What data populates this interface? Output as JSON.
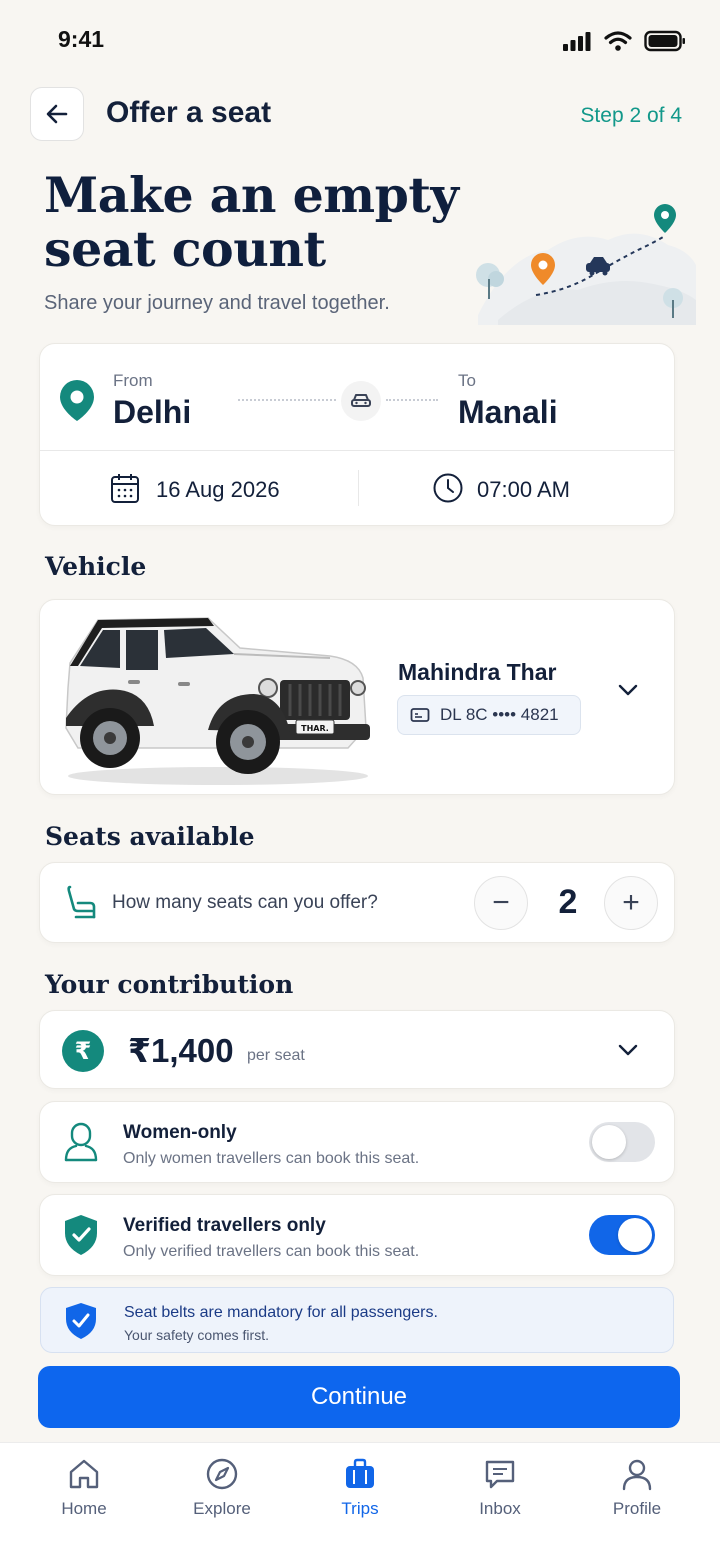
{
  "status_bar": {
    "time": "9:41"
  },
  "header": {
    "title": "Offer a seat",
    "step": "Step 2 of 4"
  },
  "hero": {
    "title": "Make an empty seat count",
    "subtitle": "Share your journey and travel together."
  },
  "route": {
    "from_label": "From",
    "from_city": "Delhi",
    "to_label": "To",
    "to_city": "Manali",
    "date": "16 Aug 2026",
    "time": "07:00 AM"
  },
  "vehicle": {
    "section_title": "Vehicle",
    "name": "Mahindra Thar",
    "plate": "DL 8C •••• 4821",
    "badge_text": "THAR."
  },
  "seats": {
    "section_title": "Seats available",
    "question": "How many seats can you offer?",
    "count": "2",
    "minus_label": "−",
    "plus_label": "+"
  },
  "contribution": {
    "section_title": "Your contribution",
    "currency_symbol": "₹",
    "price": "₹1,400",
    "unit": "per seat"
  },
  "options": [
    {
      "title": "Women-only",
      "subtitle": "Only women travellers can book this seat.",
      "enabled": false
    },
    {
      "title": "Verified travellers only",
      "subtitle": "Only verified travellers can book this seat.",
      "enabled": true
    }
  ],
  "notice": {
    "title": "Seat belts are mandatory for all passengers.",
    "subtitle": "Your safety comes first."
  },
  "continue_label": "Continue",
  "nav": [
    {
      "label": "Home",
      "icon": "home-icon"
    },
    {
      "label": "Explore",
      "icon": "compass-icon"
    },
    {
      "label": "Trips",
      "icon": "suitcase-icon",
      "active": true
    },
    {
      "label": "Inbox",
      "icon": "message-icon"
    },
    {
      "label": "Profile",
      "icon": "user-icon"
    }
  ],
  "colors": {
    "accent": "#0d66ee",
    "teal": "#14897d",
    "orange": "#ef8a2a"
  }
}
